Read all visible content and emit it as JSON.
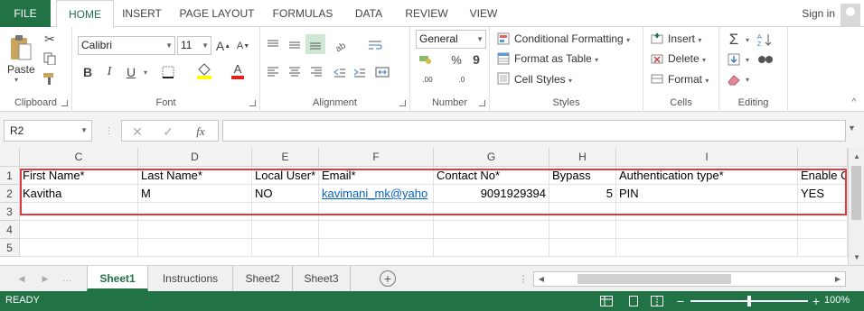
{
  "tabs": {
    "file": "FILE",
    "home": "HOME",
    "insert": "INSERT",
    "page_layout": "PAGE LAYOUT",
    "formulas": "FORMULAS",
    "data": "DATA",
    "review": "REVIEW",
    "view": "VIEW"
  },
  "signin": "Sign in",
  "clipboard": {
    "paste": "Paste",
    "label": "Clipboard"
  },
  "font": {
    "name": "Calibri",
    "size": "11",
    "label": "Font",
    "bold": "B",
    "italic": "I",
    "underline": "U",
    "grow": "A",
    "shrink": "A",
    "color_letter": "A"
  },
  "alignment": {
    "label": "Alignment"
  },
  "number": {
    "format": "General",
    "label": "Number",
    "percent": "%",
    "comma": "9",
    "dec_inc": ".00",
    "dec_dec": ".0"
  },
  "styles": {
    "conditional": "Conditional Formatting",
    "format_table": "Format as Table",
    "cell_styles": "Cell Styles",
    "label": "Styles"
  },
  "cells": {
    "insert": "Insert",
    "delete": "Delete",
    "format": "Format",
    "label": "Cells"
  },
  "editing": {
    "label": "Editing"
  },
  "formula_bar": {
    "name_box": "R2",
    "formula": "",
    "fx": "fx"
  },
  "columns": [
    "C",
    "D",
    "E",
    "F",
    "G",
    "H",
    "I",
    ""
  ],
  "rows": [
    "1",
    "2",
    "3",
    "4",
    "5"
  ],
  "table": [
    [
      "First Name*",
      "Last Name*",
      "Local User*",
      "Email*",
      "Contact No*",
      "Bypass",
      "Authentication type*",
      "Enable C"
    ],
    [
      "Kavitha",
      "M",
      "NO",
      "kavimani_mk@yaho",
      "9091929394",
      "5",
      "PIN",
      "YES"
    ]
  ],
  "sheets": [
    "Sheet1",
    "Instructions",
    "Sheet2",
    "Sheet3"
  ],
  "status": {
    "ready": "READY",
    "zoom": "100%"
  }
}
